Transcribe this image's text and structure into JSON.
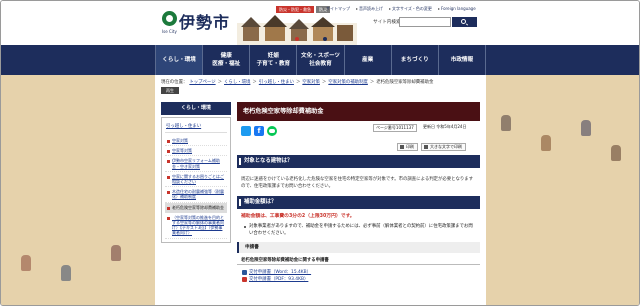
{
  "header": {
    "logo_text": "伊勢市",
    "logo_sub": "Ise City",
    "top_pills": [
      {
        "label": "防災・防犯・救急",
        "color": "#c9342c"
      },
      {
        "label": "防災",
        "color": "#7b7b7b"
      }
    ],
    "util_links": [
      "サイトマップ",
      "音声読み上げ",
      "文字サイズ・色の変更",
      "Foreign language"
    ],
    "search_label": "サイト内検索",
    "search_placeholder": "",
    "search_icon": "search-icon"
  },
  "nav": {
    "items": [
      {
        "label": "くらし・環境"
      },
      {
        "label": "健康\n医療・福祉"
      },
      {
        "label": "妊娠\n子育て・教育"
      },
      {
        "label": "文化・スポーツ\n社会教育"
      },
      {
        "label": "産業"
      },
      {
        "label": "まちづくり"
      },
      {
        "label": "市政情報"
      }
    ]
  },
  "breadcrumb": {
    "prefix": "現在の位置：",
    "items": [
      "トップページ",
      "くらし・環境",
      "引っ越し・住まい",
      "空家対策",
      "空家対策の補助制度"
    ],
    "current": "老朽危険空家等除却費補助金"
  },
  "print_badge": "再生",
  "sidebar": {
    "title": "くらし・環境",
    "parent": "引っ越し・住まい",
    "items": [
      {
        "label": "空家対策",
        "active": false
      },
      {
        "label": "空家等対策",
        "active": false
      },
      {
        "label": "伊勢市空家リフォーム補助金・空き家対策",
        "active": false
      },
      {
        "label": "空家に関するお困りごとはご相談ください",
        "active": false
      },
      {
        "label": "木造住宅の耐震補強等（耐震化）補助制度",
        "active": false
      },
      {
        "label": "老朽危険空家等除却費補助金",
        "active": true
      },
      {
        "label": "（空家等対策の推進を目的とする空家等の解体の事業者向け）【テキスト3回】（伊勢事業者向け）",
        "active": false
      }
    ]
  },
  "main": {
    "title": "老朽危険空家等除却費補助金",
    "page_id": "ページ番号1011137",
    "updated": "更新日 令和5年4月24日",
    "tools": [
      "印刷",
      "大きな文字で印刷"
    ],
    "sections": {
      "target_heading": "対象となる建物は？",
      "target_text": "周辺に迷惑をかけている老朽化した危険な空家を住宅の特定空家等が対象です。市の調査による判定が必要となりますので、住宅政策課までお問い合わせください。",
      "amount_heading": "補助金額は？",
      "amount_text": "補助金額は、工事費の3分の2（上限30万円）です。",
      "bullet_text": "対象事業者がありますので、補助金を申請するためには、必ず事前（解体業者との契約前）に住宅政策課までお問い合わせください。",
      "forms_heading": "申請書",
      "forms_subheading": "老朽危険空家等除却費補助金に関する申請書",
      "files": [
        {
          "label": "交付申請書（Word：15.4KB）",
          "icon": "word-file-icon",
          "color": "#2b579a"
        },
        {
          "label": "交付申請書（PDF：93.4KB）",
          "icon": "pdf-file-icon",
          "color": "#c9342c"
        }
      ]
    }
  },
  "colors": {
    "navy": "#1d2d5c",
    "title_bg": "#4a1014",
    "accent_red": "#c9342c",
    "bg_paper": "#ead8b8"
  }
}
